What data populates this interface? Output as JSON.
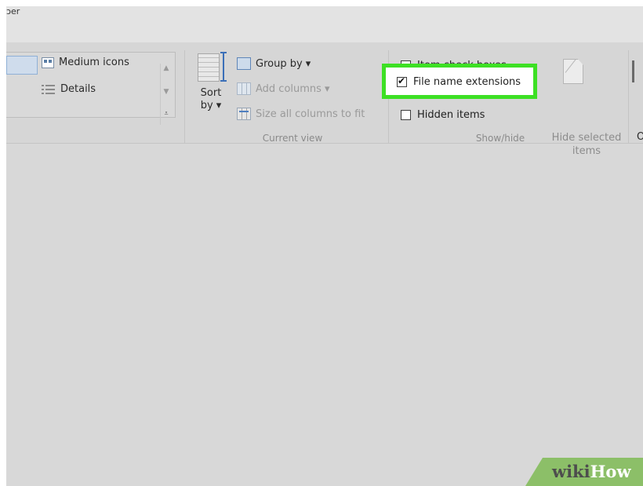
{
  "window": {
    "title_fragment": "ɔer"
  },
  "ribbon": {
    "layout": {
      "items": [
        {
          "label": "Medium icons",
          "icon": "medium-icons-icon"
        },
        {
          "label": "Details",
          "icon": "details-icon"
        }
      ]
    },
    "current_view": {
      "sort_by": {
        "line1": "Sort",
        "line2": "by ▾"
      },
      "group_by": "Group by ▾",
      "add_columns": "Add columns ▾",
      "size_all_columns": "Size all columns to fit",
      "group_label": "Current view"
    },
    "show_hide": {
      "item_check_boxes": {
        "label": "Item check boxes",
        "checked": false
      },
      "file_name_extensions": {
        "label": "File name extensions",
        "checked": true,
        "highlighted": true,
        "highlight_color": "#3de024"
      },
      "hidden_items": {
        "label": "Hidden items",
        "checked": false
      },
      "hide_selected": {
        "line1": "Hide selected",
        "line2": "items"
      },
      "group_label": "Show/hide"
    },
    "options_fragment": "O"
  },
  "watermark": {
    "wiki": "wiki",
    "how": "How"
  }
}
